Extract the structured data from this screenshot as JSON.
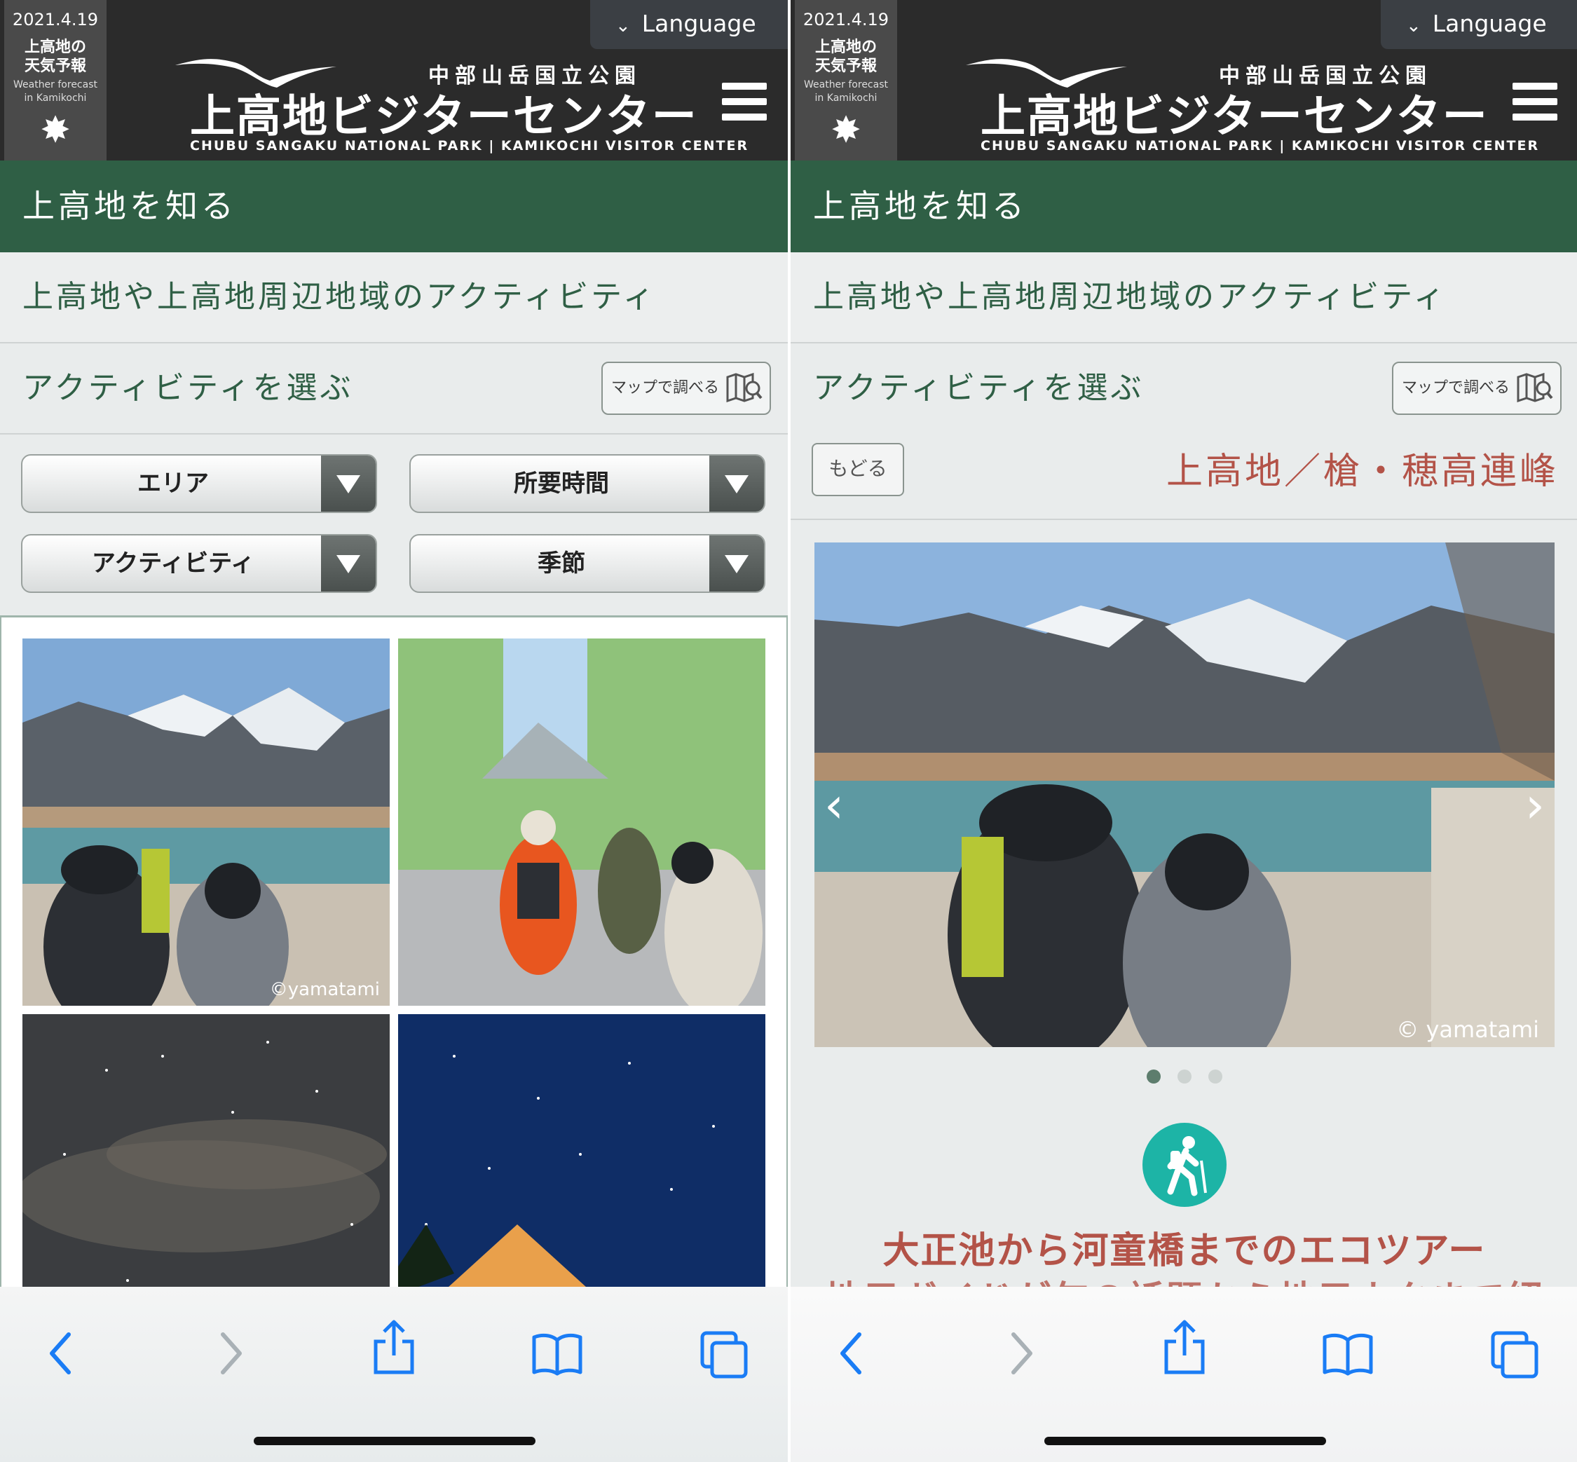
{
  "header": {
    "weather_date": "2021.4.19",
    "weather_title_1": "上高地の",
    "weather_title_2": "天気予報",
    "weather_en_1": "Weather forecast",
    "weather_en_2": "in Kamikochi",
    "weather_icon": "sun-icon",
    "language_label": "Language",
    "park_name": "中部山岳国立公園",
    "site_title": "上高地ビジターセンター",
    "site_title_en": "CHUBU SANGAKU NATIONAL PARK | KAMIKOCHI VISITOR CENTER"
  },
  "nav": {
    "section_title": "上高地を知る",
    "page_subtitle": "上高地や上高地周辺地域のアクティビティ",
    "select_title": "アクティビティを選ぶ",
    "map_button": "マップで調べる"
  },
  "filters": {
    "area": "エリア",
    "duration": "所要時間",
    "activity": "アクティビティ",
    "season": "季節"
  },
  "grid": {
    "credit": "©yamatami"
  },
  "detail": {
    "back_button": "もどる",
    "area_name": "上高地／槍・穂高連峰",
    "credit": "© yamatami",
    "slide_count": 3,
    "active_slide": 1,
    "tour_title": "大正池から河童橋までのエコツアー",
    "tour_subtitle_cut": "地元ガイドが旬の話題から地元ネタまで紹"
  },
  "colors": {
    "header_bg": "#2b2b2b",
    "brand_green": "#2f5f45",
    "accent_red": "#b35348",
    "hiker_teal": "#1db4a6",
    "ios_blue": "#1a7cf5"
  }
}
